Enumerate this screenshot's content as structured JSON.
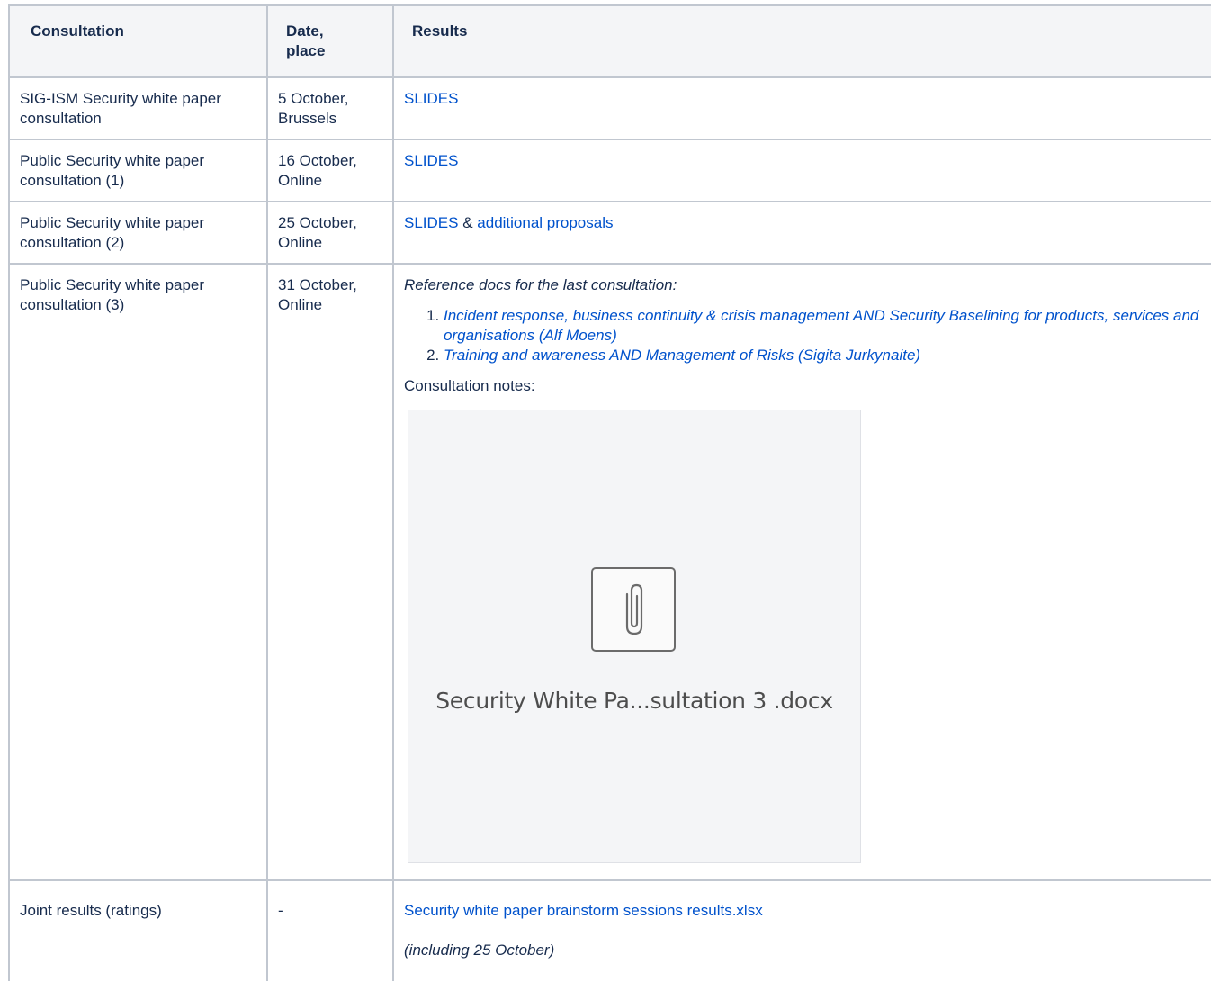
{
  "table": {
    "headers": {
      "consultation": "Consultation",
      "date_place_line1": "Date,",
      "date_place_line2": "place",
      "results": "Results"
    },
    "rows": [
      {
        "consultation": "SIG-ISM Security white paper consultation",
        "date_line1": "5 October,",
        "date_line2": "Brussels",
        "slides_link": "SLIDES"
      },
      {
        "consultation": "Public Security white paper consultation (1)",
        "date_line1": "16 October,",
        "date_line2": "Online",
        "slides_link": "SLIDES"
      },
      {
        "consultation": "Public Security white paper consultation (2)",
        "date_line1": "25 October,",
        "date_line2": "Online",
        "slides_link": "SLIDES",
        "connector": " & ",
        "extra_link": "additional proposals"
      },
      {
        "consultation": "Public Security white paper consultation (3)",
        "date_line1": "31 October,",
        "date_line2": "Online",
        "reference_intro": "Reference docs for the last consultation:",
        "reference_docs": [
          "Incident response, business continuity & crisis management AND Security Baselining for products, services and organisations (Alf Moens)",
          "Training and awareness AND Management of Risks (Sigita Jurkynaite)"
        ],
        "notes_label": "Consultation notes:",
        "attachment_name": "Security White Pa...sultation 3 .docx"
      },
      {
        "consultation": "Joint results (ratings)",
        "date_line1": "-",
        "results_link": "Security white paper brainstorm sessions results.xlsx",
        "results_note": "(including 25 October)"
      }
    ]
  },
  "colors": {
    "link": "#0052cc",
    "text": "#172b4d",
    "header_bg": "#f4f5f7",
    "border": "#c1c7d0"
  },
  "icons": {
    "attachment": "paperclip-icon"
  }
}
